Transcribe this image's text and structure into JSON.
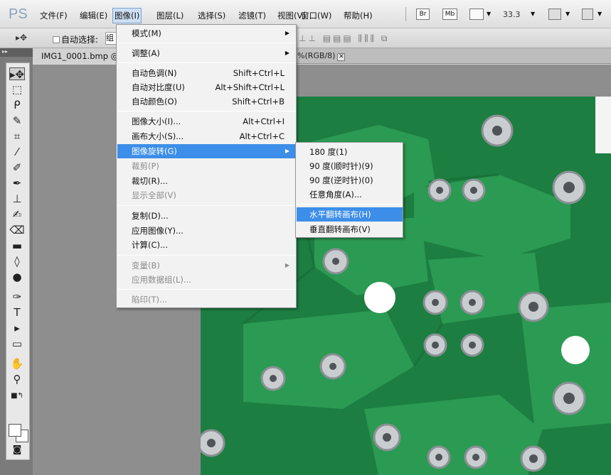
{
  "app_logo": "PS",
  "menubar": {
    "items": [
      "文件(F)",
      "编辑(E)",
      "图像(I)",
      "图层(L)",
      "选择(S)",
      "滤镜(T)",
      "视图(V)",
      "窗口(W)",
      "帮助(H)"
    ],
    "br_label": "Br",
    "mb_label": "Mb",
    "zoom": "33.3"
  },
  "options": {
    "tool_glyph": "▸✥",
    "autoselect_label": "自动选择:",
    "group_value": "组"
  },
  "document": {
    "tab_name": "IMG1_0001.bmp @",
    "tab_tail": "%(RGB/8)",
    "close_glyph": "✕"
  },
  "image_menu": {
    "items": [
      {
        "label": "模式(M)",
        "shortcut": "",
        "submenu": true,
        "disabled": false
      },
      {
        "label": "调整(A)",
        "shortcut": "",
        "submenu": true,
        "disabled": false
      },
      {
        "label": "自动色调(N)",
        "shortcut": "Shift+Ctrl+L",
        "submenu": false,
        "disabled": false
      },
      {
        "label": "自动对比度(U)",
        "shortcut": "Alt+Shift+Ctrl+L",
        "submenu": false,
        "disabled": false
      },
      {
        "label": "自动颜色(O)",
        "shortcut": "Shift+Ctrl+B",
        "submenu": false,
        "disabled": false
      },
      {
        "label": "图像大小(I)...",
        "shortcut": "Alt+Ctrl+I",
        "submenu": false,
        "disabled": false
      },
      {
        "label": "画布大小(S)...",
        "shortcut": "Alt+Ctrl+C",
        "submenu": false,
        "disabled": false
      },
      {
        "label": "图像旋转(G)",
        "shortcut": "",
        "submenu": true,
        "disabled": false,
        "highlighted": true
      },
      {
        "label": "裁剪(P)",
        "shortcut": "",
        "submenu": false,
        "disabled": true
      },
      {
        "label": "裁切(R)...",
        "shortcut": "",
        "submenu": false,
        "disabled": false
      },
      {
        "label": "显示全部(V)",
        "shortcut": "",
        "submenu": false,
        "disabled": true
      },
      {
        "label": "复制(D)...",
        "shortcut": "",
        "submenu": false,
        "disabled": false
      },
      {
        "label": "应用图像(Y)...",
        "shortcut": "",
        "submenu": false,
        "disabled": false
      },
      {
        "label": "计算(C)...",
        "shortcut": "",
        "submenu": false,
        "disabled": false
      },
      {
        "label": "变量(B)",
        "shortcut": "",
        "submenu": true,
        "disabled": true
      },
      {
        "label": "应用数据组(L)...",
        "shortcut": "",
        "submenu": false,
        "disabled": true
      },
      {
        "label": "陷印(T)...",
        "shortcut": "",
        "submenu": false,
        "disabled": true
      }
    ]
  },
  "rotate_submenu": {
    "items": [
      {
        "label": "180 度(1)",
        "highlighted": false
      },
      {
        "label": "90 度(顺时针)(9)",
        "highlighted": false
      },
      {
        "label": "90 度(逆时针)(0)",
        "highlighted": false
      },
      {
        "label": "任意角度(A)...",
        "highlighted": false
      },
      {
        "label": "水平翻转画布(H)",
        "highlighted": true
      },
      {
        "label": "垂直翻转画布(V)",
        "highlighted": false
      }
    ]
  },
  "colors": {
    "menu_highlight": "#3c8ee8",
    "pcb_green": "#1f8a45",
    "pcb_trace": "#2d9b52"
  }
}
